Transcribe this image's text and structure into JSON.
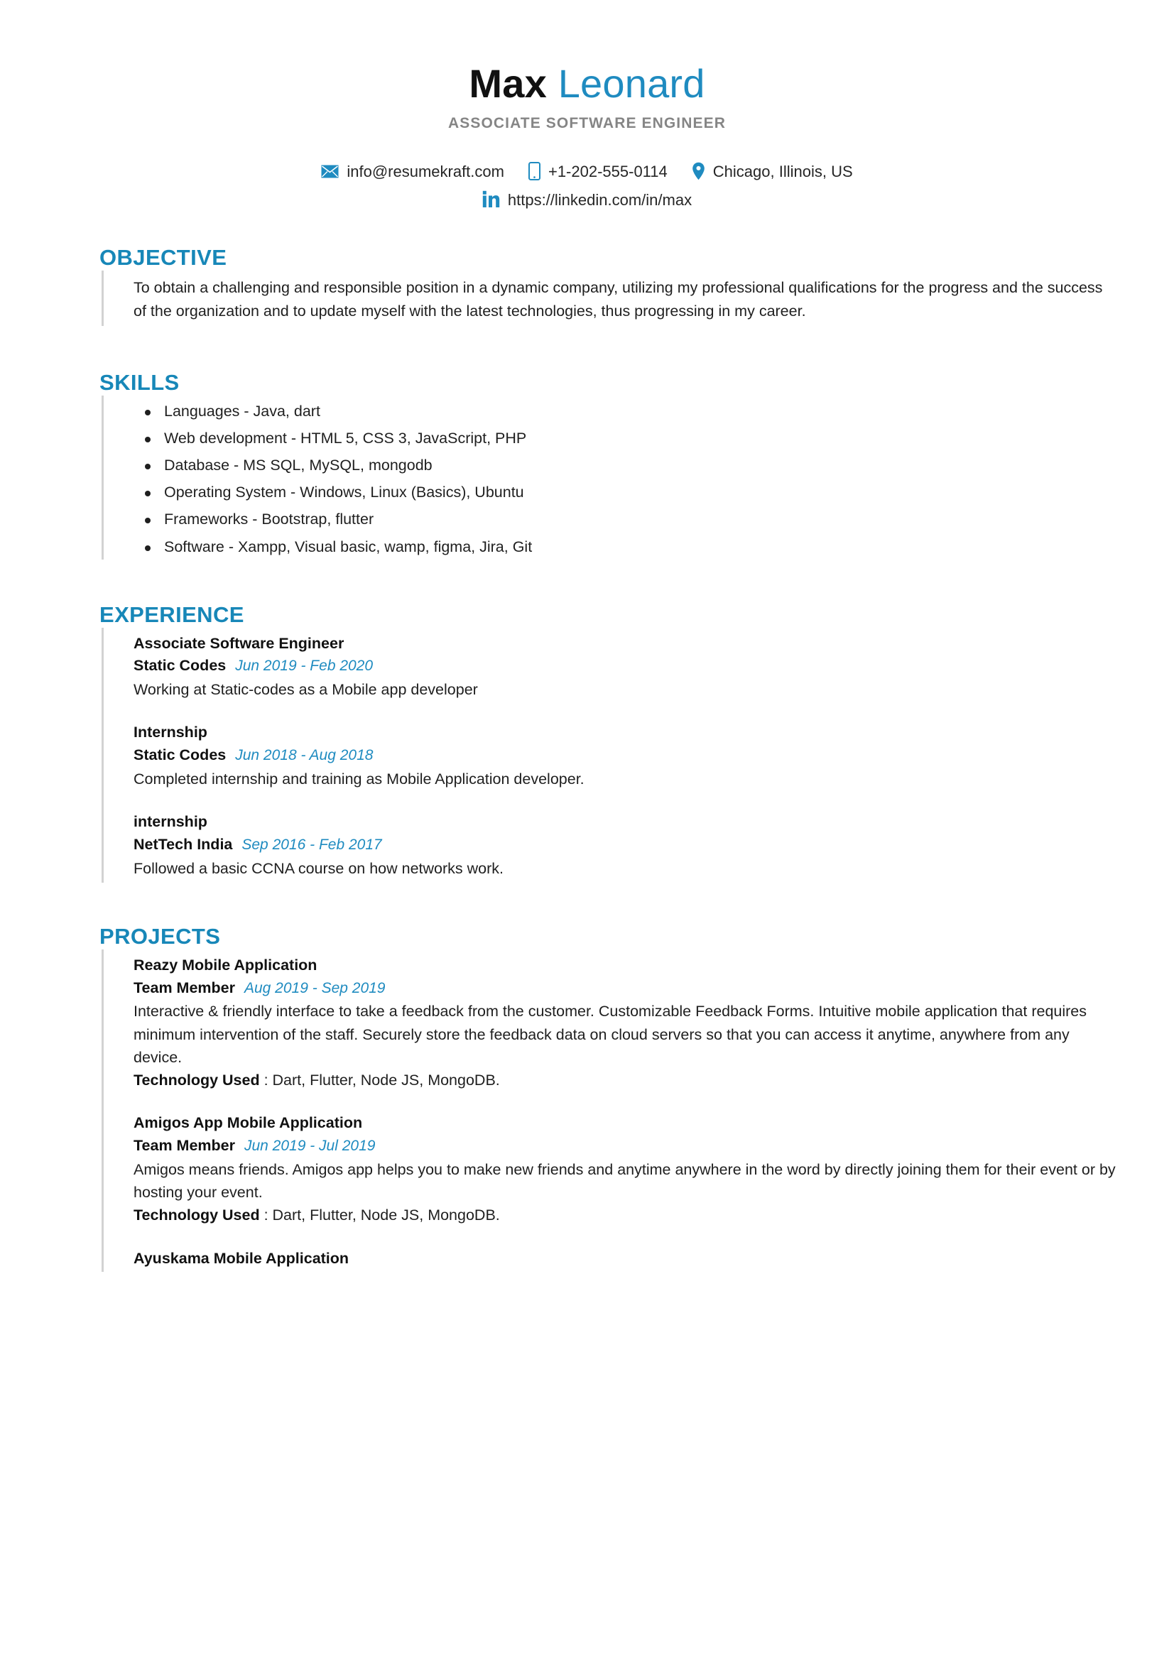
{
  "header": {
    "first_name": "Max",
    "last_name": "Leonard",
    "job_title": "ASSOCIATE SOFTWARE ENGINEER",
    "accent_color": "#1f8bc0",
    "heading_color": "#1787b8",
    "subtitle_color": "#858585",
    "contacts": [
      {
        "icon": "envelope-icon",
        "value": "info@resumekraft.com"
      },
      {
        "icon": "phone-icon",
        "value": "+1-202-555-0114"
      },
      {
        "icon": "location-pin-icon",
        "value": "Chicago, Illinois, US"
      }
    ],
    "linkedin": {
      "icon": "linkedin-icon",
      "value": "https://linkedin.com/in/max"
    }
  },
  "objective": {
    "heading": "OBJECTIVE",
    "text": "To obtain a challenging and responsible position in a dynamic company, utilizing my professional qualifications for the progress and the success of the organization and to update myself with the latest technologies, thus progressing in my career."
  },
  "skills": {
    "heading": "SKILLS",
    "items": [
      "Languages - Java, dart",
      "Web development - HTML 5, CSS 3, JavaScript, PHP",
      "Database - MS SQL, MySQL, mongodb",
      "Operating System - Windows, Linux (Basics), Ubuntu",
      "Frameworks - Bootstrap, flutter",
      "Software - Xampp, Visual basic, wamp, figma, Jira, Git"
    ]
  },
  "experience": {
    "heading": "EXPERIENCE",
    "entries": [
      {
        "title": "Associate Software Engineer",
        "org": "Static Codes",
        "date": "Jun 2019 - Feb 2020",
        "desc": "Working at Static-codes as a Mobile app developer"
      },
      {
        "title": "Internship",
        "org": "Static Codes",
        "date": "Jun 2018 - Aug 2018",
        "desc": "Completed internship and training as Mobile Application developer."
      },
      {
        "title": "internship",
        "org": "NetTech India",
        "date": "Sep 2016 - Feb 2017",
        "desc": "Followed a basic CCNA course on how networks work."
      }
    ]
  },
  "projects": {
    "heading": "PROJECTS",
    "tech_label": "Technology Used",
    "entries": [
      {
        "title": "Reazy Mobile Application",
        "role": "Team Member",
        "date": "Aug 2019 - Sep 2019",
        "desc": "Interactive & friendly interface to take a feedback from the customer. Customizable Feedback Forms. Intuitive mobile application that requires minimum intervention of the staff. Securely store the feedback data on cloud servers so that you can access it anytime, anywhere from any device.",
        "tech_value": " : Dart, Flutter, Node JS, MongoDB."
      },
      {
        "title": "Amigos App Mobile Application",
        "role": "Team Member",
        "date": "Jun 2019 - Jul 2019",
        "desc": "Amigos means friends. Amigos app helps you to make new friends and anytime anywhere in the word by directly joining them for their event or by hosting your event.",
        "tech_value": " : Dart, Flutter, Node JS, MongoDB."
      },
      {
        "title": "Ayuskama Mobile Application",
        "role": "",
        "date": "",
        "desc": "",
        "tech_value": ""
      }
    ]
  }
}
